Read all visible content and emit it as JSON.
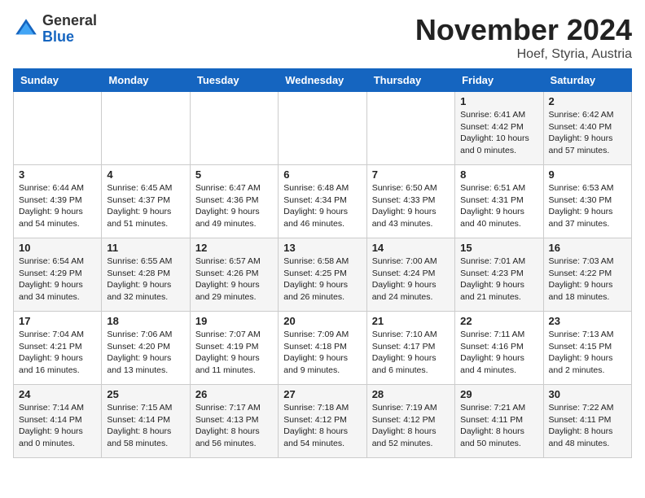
{
  "logo": {
    "line1": "General",
    "line2": "Blue"
  },
  "title": "November 2024",
  "location": "Hoef, Styria, Austria",
  "days_of_week": [
    "Sunday",
    "Monday",
    "Tuesday",
    "Wednesday",
    "Thursday",
    "Friday",
    "Saturday"
  ],
  "weeks": [
    [
      {
        "day": "",
        "detail": ""
      },
      {
        "day": "",
        "detail": ""
      },
      {
        "day": "",
        "detail": ""
      },
      {
        "day": "",
        "detail": ""
      },
      {
        "day": "",
        "detail": ""
      },
      {
        "day": "1",
        "detail": "Sunrise: 6:41 AM\nSunset: 4:42 PM\nDaylight: 10 hours\nand 0 minutes."
      },
      {
        "day": "2",
        "detail": "Sunrise: 6:42 AM\nSunset: 4:40 PM\nDaylight: 9 hours\nand 57 minutes."
      }
    ],
    [
      {
        "day": "3",
        "detail": "Sunrise: 6:44 AM\nSunset: 4:39 PM\nDaylight: 9 hours\nand 54 minutes."
      },
      {
        "day": "4",
        "detail": "Sunrise: 6:45 AM\nSunset: 4:37 PM\nDaylight: 9 hours\nand 51 minutes."
      },
      {
        "day": "5",
        "detail": "Sunrise: 6:47 AM\nSunset: 4:36 PM\nDaylight: 9 hours\nand 49 minutes."
      },
      {
        "day": "6",
        "detail": "Sunrise: 6:48 AM\nSunset: 4:34 PM\nDaylight: 9 hours\nand 46 minutes."
      },
      {
        "day": "7",
        "detail": "Sunrise: 6:50 AM\nSunset: 4:33 PM\nDaylight: 9 hours\nand 43 minutes."
      },
      {
        "day": "8",
        "detail": "Sunrise: 6:51 AM\nSunset: 4:31 PM\nDaylight: 9 hours\nand 40 minutes."
      },
      {
        "day": "9",
        "detail": "Sunrise: 6:53 AM\nSunset: 4:30 PM\nDaylight: 9 hours\nand 37 minutes."
      }
    ],
    [
      {
        "day": "10",
        "detail": "Sunrise: 6:54 AM\nSunset: 4:29 PM\nDaylight: 9 hours\nand 34 minutes."
      },
      {
        "day": "11",
        "detail": "Sunrise: 6:55 AM\nSunset: 4:28 PM\nDaylight: 9 hours\nand 32 minutes."
      },
      {
        "day": "12",
        "detail": "Sunrise: 6:57 AM\nSunset: 4:26 PM\nDaylight: 9 hours\nand 29 minutes."
      },
      {
        "day": "13",
        "detail": "Sunrise: 6:58 AM\nSunset: 4:25 PM\nDaylight: 9 hours\nand 26 minutes."
      },
      {
        "day": "14",
        "detail": "Sunrise: 7:00 AM\nSunset: 4:24 PM\nDaylight: 9 hours\nand 24 minutes."
      },
      {
        "day": "15",
        "detail": "Sunrise: 7:01 AM\nSunset: 4:23 PM\nDaylight: 9 hours\nand 21 minutes."
      },
      {
        "day": "16",
        "detail": "Sunrise: 7:03 AM\nSunset: 4:22 PM\nDaylight: 9 hours\nand 18 minutes."
      }
    ],
    [
      {
        "day": "17",
        "detail": "Sunrise: 7:04 AM\nSunset: 4:21 PM\nDaylight: 9 hours\nand 16 minutes."
      },
      {
        "day": "18",
        "detail": "Sunrise: 7:06 AM\nSunset: 4:20 PM\nDaylight: 9 hours\nand 13 minutes."
      },
      {
        "day": "19",
        "detail": "Sunrise: 7:07 AM\nSunset: 4:19 PM\nDaylight: 9 hours\nand 11 minutes."
      },
      {
        "day": "20",
        "detail": "Sunrise: 7:09 AM\nSunset: 4:18 PM\nDaylight: 9 hours\nand 9 minutes."
      },
      {
        "day": "21",
        "detail": "Sunrise: 7:10 AM\nSunset: 4:17 PM\nDaylight: 9 hours\nand 6 minutes."
      },
      {
        "day": "22",
        "detail": "Sunrise: 7:11 AM\nSunset: 4:16 PM\nDaylight: 9 hours\nand 4 minutes."
      },
      {
        "day": "23",
        "detail": "Sunrise: 7:13 AM\nSunset: 4:15 PM\nDaylight: 9 hours\nand 2 minutes."
      }
    ],
    [
      {
        "day": "24",
        "detail": "Sunrise: 7:14 AM\nSunset: 4:14 PM\nDaylight: 9 hours\nand 0 minutes."
      },
      {
        "day": "25",
        "detail": "Sunrise: 7:15 AM\nSunset: 4:14 PM\nDaylight: 8 hours\nand 58 minutes."
      },
      {
        "day": "26",
        "detail": "Sunrise: 7:17 AM\nSunset: 4:13 PM\nDaylight: 8 hours\nand 56 minutes."
      },
      {
        "day": "27",
        "detail": "Sunrise: 7:18 AM\nSunset: 4:12 PM\nDaylight: 8 hours\nand 54 minutes."
      },
      {
        "day": "28",
        "detail": "Sunrise: 7:19 AM\nSunset: 4:12 PM\nDaylight: 8 hours\nand 52 minutes."
      },
      {
        "day": "29",
        "detail": "Sunrise: 7:21 AM\nSunset: 4:11 PM\nDaylight: 8 hours\nand 50 minutes."
      },
      {
        "day": "30",
        "detail": "Sunrise: 7:22 AM\nSunset: 4:11 PM\nDaylight: 8 hours\nand 48 minutes."
      }
    ]
  ]
}
